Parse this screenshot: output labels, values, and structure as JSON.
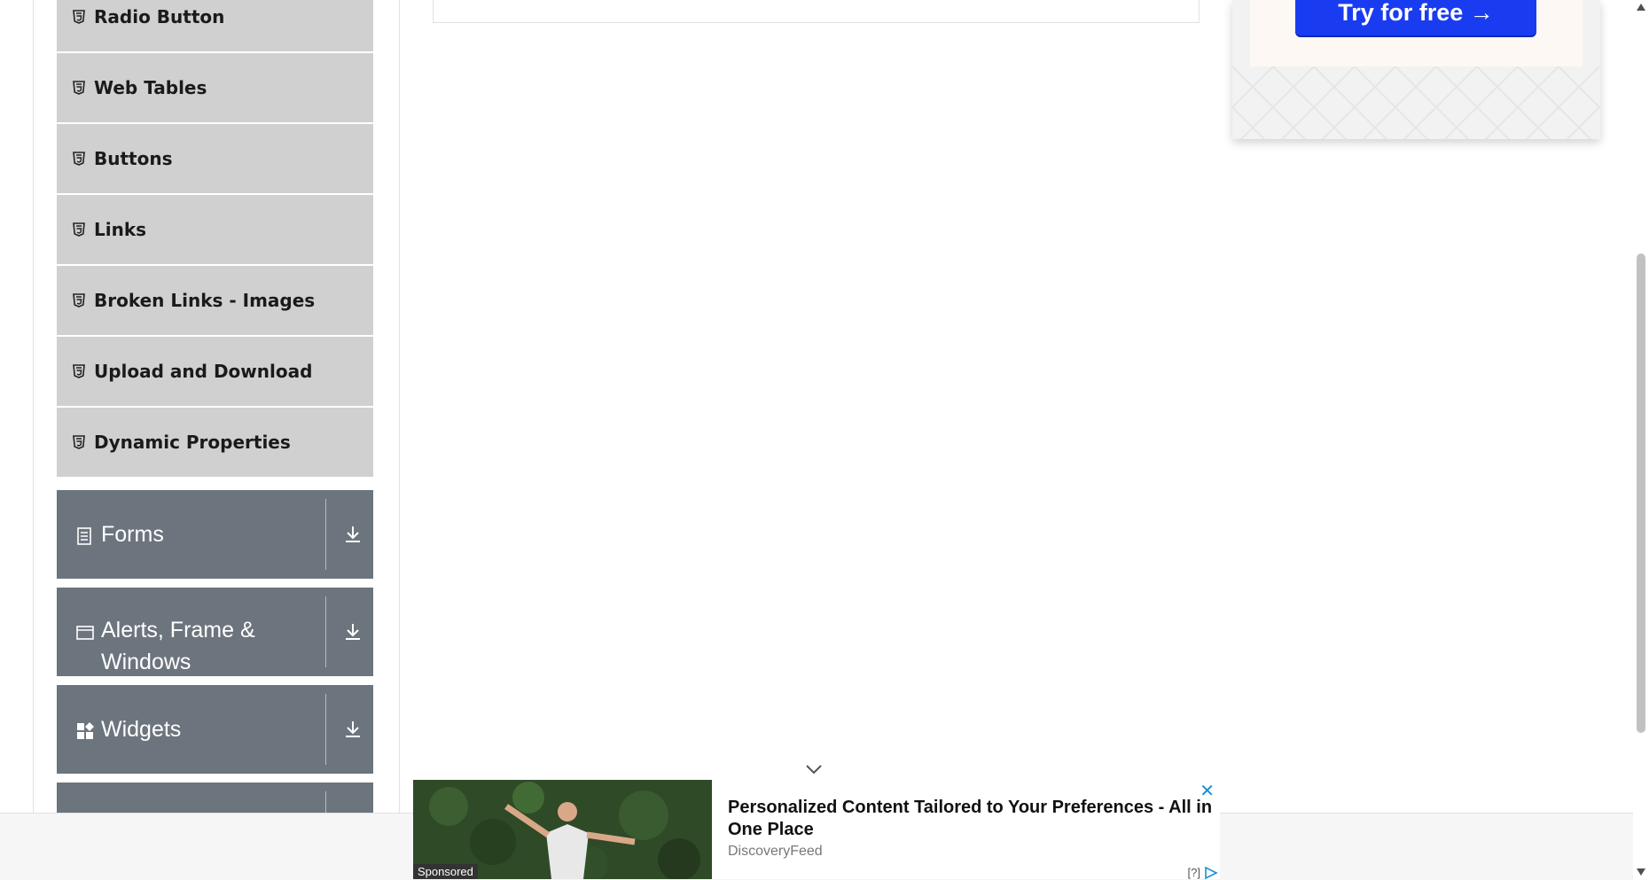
{
  "sidebar": {
    "items": [
      {
        "label": "Radio Button"
      },
      {
        "label": "Web Tables"
      },
      {
        "label": "Buttons"
      },
      {
        "label": "Links"
      },
      {
        "label": "Broken Links - Images"
      },
      {
        "label": "Upload and Download"
      },
      {
        "label": "Dynamic Properties"
      }
    ],
    "groups": [
      {
        "label": "Forms",
        "icon": "form-icon"
      },
      {
        "label": "Alerts, Frame & Windows",
        "icon": "window-icon"
      },
      {
        "label": "Widgets",
        "icon": "widgets-icon"
      }
    ]
  },
  "top_ad": {
    "button_label": "Try for free →"
  },
  "bottom_ad": {
    "headline": "Personalized Content Tailored to Your Preferences - All in One Place",
    "source": "DiscoveryFeed",
    "sponsored": "Sponsored",
    "close": "✕",
    "info": "[?]"
  },
  "colors": {
    "menu_bg": "#d0d0d0",
    "group_bg": "#6c757d",
    "try_button": "#1a3cf0"
  }
}
